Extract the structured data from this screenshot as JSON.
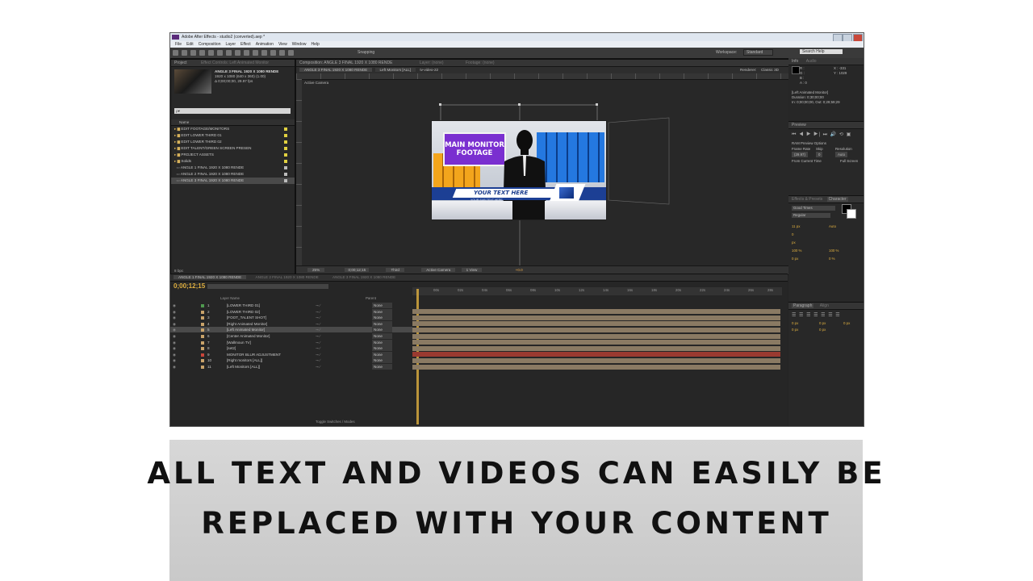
{
  "app": {
    "title": "Adobe After Effects - studio2 (converted).aep *",
    "menu": [
      "File",
      "Edit",
      "Composition",
      "Layer",
      "Effect",
      "Animation",
      "View",
      "Window",
      "Help"
    ],
    "snapping": "Snapping",
    "workspace_label": "Workspace:",
    "workspace_value": "Standard",
    "search_help": "Search Help"
  },
  "project": {
    "tab": "Project",
    "effect_controls_tab": "Effect Controls: Left Animated Monitor",
    "comp_name": "ANGLE 3 FINAL 1920 X 1080 RENDE",
    "comp_info1": "1920 x 1080 (640 x 360) (1.00)",
    "comp_info2": "Δ 0;00;00;00, 29.97 fps",
    "search_placeholder": "ρ▾",
    "col_name": "Name",
    "items": [
      "EDIT FOOTAGE/MONITORS",
      "EDIT LOWER THIRD 01",
      "EDIT LOWER THIRD 02",
      "EDIT TALENT/GREEN SCREEN PRESEN",
      "PROJECT ASSETS",
      "Solids",
      "ANGLE 1 FINAL 1920 X 1080 RENDE",
      "ANGLE 2 FINAL 1920 X 1080 RENDE",
      "ANGLE 3 FINAL 1920 X 1080 RENDE"
    ],
    "bpc": "8 bpc"
  },
  "composition": {
    "tab": "Composition: ANGLE 3 FINAL 1920 X 1080 RENDE",
    "layer_tab": "Layer: (none)",
    "footage_tab": "Footage: (none)",
    "nav_comp": "ANGLE 3 FINAL 1920 X 1080 RENDE",
    "nav_layer": "Left Monitors [ALL]",
    "nav_extra": "tv-video-22",
    "renderer_label": "Renderer:",
    "renderer_value": "Classic 3D",
    "camera_label": "Active Camera",
    "zoom": "25%",
    "timecode": "0;00;12;15",
    "resolution": "Third",
    "view_camera": "Active Camera",
    "views": "1 View",
    "offset": "+0.0"
  },
  "composite_frame": {
    "main_monitor": "MAIN MONITOR FOOTAGE",
    "lower_third": "YOUR TEXT HERE",
    "lower_sub": "YOUR SUB TEXT HERE"
  },
  "timeline": {
    "tabs": [
      "ANGLE 1 FINAL 1920 X 1080 RENDE",
      "ANGLE 2 FINAL 1920 X 1080 RENDE",
      "ANGLE 3 FINAL 1920 X 1080 RENDE"
    ],
    "timecode": "0;00;12;15",
    "col_layer_name": "Layer Name",
    "col_parent": "Parent",
    "ruler": [
      "00s",
      "02s",
      "04s",
      "06s",
      "08s",
      "10s",
      "12s",
      "14s",
      "16s",
      "18s",
      "20s",
      "22s",
      "24s",
      "26s",
      "28s",
      "30s"
    ],
    "layers": [
      {
        "num": "1",
        "name": "[LOWER THIRD 01]",
        "parent": "None",
        "color": "#4f9a4f"
      },
      {
        "num": "2",
        "name": "[LOWER THIRD 02]",
        "parent": "None",
        "color": "#c9a36a"
      },
      {
        "num": "3",
        "name": "[FOOT_TALENT SHOT]",
        "parent": "None",
        "color": "#c9a36a"
      },
      {
        "num": "4",
        "name": "[Right Animated Monitor]",
        "parent": "None",
        "color": "#c9a36a"
      },
      {
        "num": "5",
        "name": "[Left Animated Monitor]",
        "parent": "None",
        "color": "#c9a36a"
      },
      {
        "num": "6",
        "name": "[Center Animated Monitor]",
        "parent": "None",
        "color": "#c9a36a"
      },
      {
        "num": "7",
        "name": "[Wallmoun TV]",
        "parent": "None",
        "color": "#c9a36a"
      },
      {
        "num": "8",
        "name": "[set2]",
        "parent": "None",
        "color": "#c9a36a"
      },
      {
        "num": "9",
        "name": "MONITOR BLUR ADJUSTMENT",
        "parent": "None",
        "color": "#c9453a"
      },
      {
        "num": "10",
        "name": "[Right monitors [ALL]]",
        "parent": "None",
        "color": "#c9a36a"
      },
      {
        "num": "11",
        "name": "[Left Monitors [ALL]]",
        "parent": "None",
        "color": "#c9a36a"
      }
    ],
    "toggle_label": "Toggle Switches / Modes"
  },
  "info_panel": {
    "tabs": [
      "Info",
      "Audio"
    ],
    "r": "R :",
    "g": "G :",
    "b": "B :",
    "a": "A : 0",
    "x": "X : -331",
    "y": "Y : 1029",
    "selection": "[Left Animated Monitor]",
    "duration": "Duration: 0;30;00;00",
    "inout": "In: 0;00;00;00, Out: 0;29;59;29"
  },
  "preview_panel": {
    "tab": "Preview",
    "ram_options": "RAM Preview Options",
    "frame_rate": "Frame Rate",
    "skip": "Skip",
    "resolution": "Resolution",
    "fr_value": "(29.97)",
    "skip_value": "0",
    "res_value": "Auto",
    "from_current": "From Current Time",
    "full_screen": "Full Screen"
  },
  "character_panel": {
    "tabs": [
      "Effects & Presets",
      "Character"
    ],
    "font": "Good Times",
    "style": "Regular",
    "size": "11 px",
    "leading": "Auto",
    "tracking": "0",
    "scale_v": "100 %",
    "scale_h": "100 %",
    "baseline": "0 px",
    "tsume": "0 %",
    "unit": "px"
  },
  "paragraph_panel": {
    "tabs": [
      "Paragraph",
      "Align"
    ],
    "indent_left": "0 px",
    "indent_right": "0 px",
    "space_before": "0 px",
    "space_after": "0 px",
    "first_line": "0 px"
  },
  "caption": {
    "line1": "ALL TEXT AND VIDEOS CAN EASILY BE",
    "line2": "REPLACED WITH YOUR CONTENT"
  }
}
